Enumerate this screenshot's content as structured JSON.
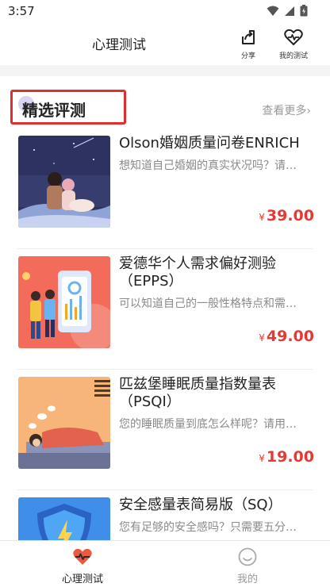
{
  "status_bar": {
    "time": "3:57"
  },
  "header": {
    "title": "心理测试",
    "share_label": "分享",
    "my_tests_label": "我的测试"
  },
  "section": {
    "title": "精选评测",
    "more_label": "查看更多",
    "more_chevron": "›"
  },
  "currency_symbol": "¥",
  "tests": [
    {
      "title": "Olson婚姻质量问卷ENRICH",
      "desc": "想知道自己婚姻的真实状况吗？请…",
      "price": "39.00",
      "image": "couple-night-illustration"
    },
    {
      "title": "爱德华个人需求偏好测验（EPPS）",
      "desc": "可以知道自己的一般性格特点和需…",
      "price": "49.00",
      "image": "people-with-phone-illustration"
    },
    {
      "title": "匹兹堡睡眠质量指数量表（PSQI）",
      "desc": "您的睡眠质量到底怎么样呢？请用…",
      "price": "19.00",
      "image": "sleeping-person-illustration"
    },
    {
      "title": "安全感量表简易版（SQ）",
      "desc": "您有足够的安全感吗？只需要五分…",
      "price": "",
      "image": "shield-illustration"
    }
  ],
  "tab_bar": {
    "tabs": [
      {
        "label": "心理测试",
        "icon": "heart-pulse-icon",
        "active": true
      },
      {
        "label": "我的",
        "icon": "smiley-icon",
        "active": false
      }
    ]
  },
  "colors": {
    "accent_red": "#e53935",
    "highlight_box": "#e02d2d",
    "muted_text": "#8a8a8a"
  }
}
